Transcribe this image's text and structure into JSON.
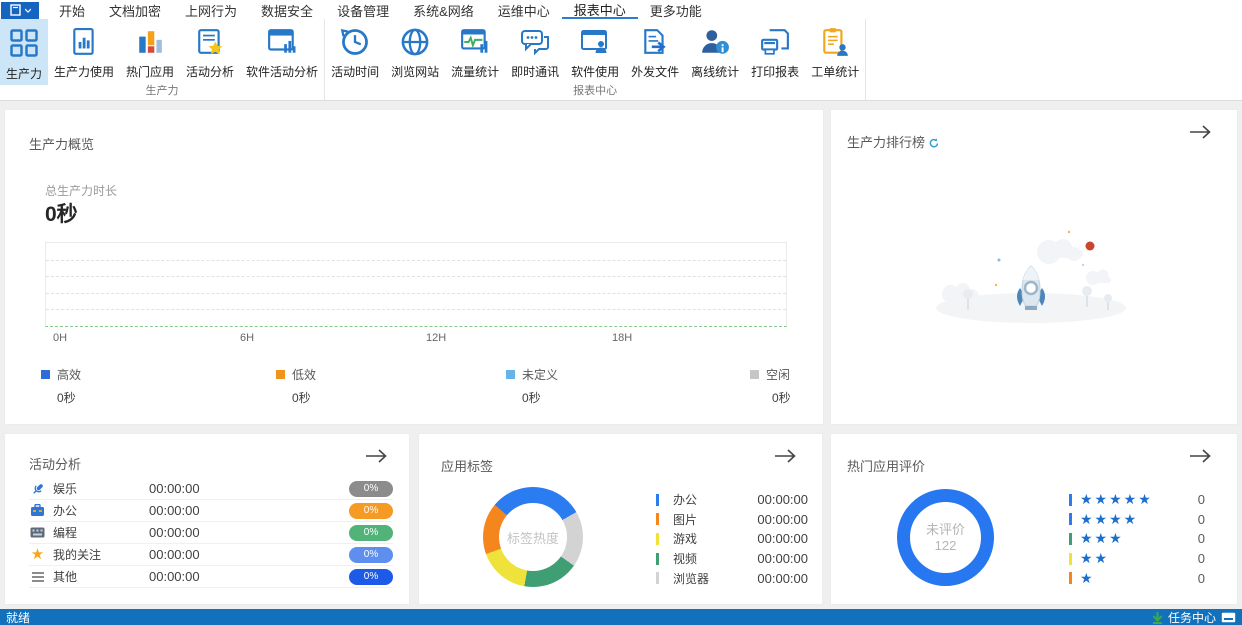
{
  "menu": {
    "items": [
      {
        "label": "开始"
      },
      {
        "label": "文档加密"
      },
      {
        "label": "上网行为"
      },
      {
        "label": "数据安全"
      },
      {
        "label": "设备管理"
      },
      {
        "label": "系统&网络"
      },
      {
        "label": "运维中心"
      },
      {
        "label": "报表中心"
      },
      {
        "label": "更多功能"
      }
    ],
    "active_label": "报表中心"
  },
  "ribbon": {
    "groups": [
      {
        "label": "生产力",
        "items": [
          {
            "label": "生产力"
          },
          {
            "label": "生产力使用"
          },
          {
            "label": "热门应用"
          },
          {
            "label": "活动分析"
          },
          {
            "label": "软件活动分析"
          }
        ]
      },
      {
        "label": "报表中心",
        "items": [
          {
            "label": "活动时间"
          },
          {
            "label": "浏览网站"
          },
          {
            "label": "流量统计"
          },
          {
            "label": "即时通讯"
          },
          {
            "label": "软件使用"
          },
          {
            "label": "外发文件"
          },
          {
            "label": "离线统计"
          },
          {
            "label": "打印报表"
          },
          {
            "label": "工单统计"
          }
        ]
      }
    ]
  },
  "overview": {
    "title": "生产力概览",
    "metric_label": "总生产力时长",
    "metric_value": "0秒",
    "x_labels": [
      "0H",
      "6H",
      "12H",
      "18H"
    ],
    "legend": [
      {
        "label": "高效",
        "value": "0秒",
        "color": "#2e6cd9"
      },
      {
        "label": "低效",
        "value": "0秒",
        "color": "#f0941c"
      },
      {
        "label": "未定义",
        "value": "0秒",
        "color": "#67b2e8"
      },
      {
        "label": "空闲",
        "value": "0秒",
        "color": "#c6c6c6"
      }
    ]
  },
  "ranking": {
    "title": "生产力排行榜"
  },
  "activity": {
    "title": "活动分析",
    "rows": [
      {
        "icon": "microphone-icon",
        "label": "娱乐",
        "time": "00:00:00",
        "percent": "0%",
        "badge_color": "#8c8c8c"
      },
      {
        "icon": "briefcase-icon",
        "label": "办公",
        "time": "00:00:00",
        "percent": "0%",
        "badge_color": "#f59a23"
      },
      {
        "icon": "keyboard-icon",
        "label": "编程",
        "time": "00:00:00",
        "percent": "0%",
        "badge_color": "#52b378"
      },
      {
        "icon": "star-icon",
        "label": "我的关注",
        "time": "00:00:00",
        "percent": "0%",
        "badge_color": "#5e8fee"
      },
      {
        "icon": "menu-lines-icon",
        "label": "其他",
        "time": "00:00:00",
        "percent": "0%",
        "badge_color": "#1e5ae8"
      }
    ]
  },
  "app_tags": {
    "title": "应用标签",
    "center_label": "标签热度",
    "rows": [
      {
        "label": "办公",
        "time": "00:00:00",
        "color": "#2b7cf0"
      },
      {
        "label": "图片",
        "time": "00:00:00",
        "color": "#f5851d"
      },
      {
        "label": "游戏",
        "time": "00:00:00",
        "color": "#efe23a"
      },
      {
        "label": "视频",
        "time": "00:00:00",
        "color": "#3f9e74"
      },
      {
        "label": "浏览器",
        "time": "00:00:00",
        "color": "#d3d3d3"
      }
    ],
    "donut": {
      "start_deg": -50,
      "segments": [
        {
          "name": "办公",
          "color": "#2b7cf0",
          "deg": 110
        },
        {
          "name": "浏览器",
          "color": "#d3d3d3",
          "deg": 65
        },
        {
          "name": "视频",
          "color": "#3f9e74",
          "deg": 65
        },
        {
          "name": "游戏",
          "color": "#efe23a",
          "deg": 60
        },
        {
          "name": "图片",
          "color": "#f5851d",
          "deg": 60
        }
      ]
    }
  },
  "ratings": {
    "title": "热门应用评价",
    "center_label": "未评价",
    "center_value": "122",
    "ring_color": "#2677f0",
    "rows": [
      {
        "stars": "★★★★★",
        "count": "0",
        "color": "#2b7cf0"
      },
      {
        "stars": "★★★★",
        "count": "0",
        "color": "#2b7cf0"
      },
      {
        "stars": "★★★",
        "count": "0",
        "color": "#3f9e74"
      },
      {
        "stars": "★★",
        "count": "0",
        "color": "#efe23a"
      },
      {
        "stars": "★",
        "count": "0",
        "color": "#f5851d"
      }
    ]
  },
  "statusbar": {
    "left": "就绪",
    "right": "任务中心"
  },
  "chart_data": [
    {
      "type": "area",
      "title": "生产力概览",
      "xlabel": "",
      "ylabel": "",
      "x_ticks": [
        "0H",
        "6H",
        "12H",
        "18H"
      ],
      "x_range_hours": [
        0,
        24
      ],
      "grid": "dashed-horizontal",
      "series": [
        {
          "name": "高效",
          "total": "0秒",
          "values": []
        },
        {
          "name": "低效",
          "total": "0秒",
          "values": []
        },
        {
          "name": "未定义",
          "total": "0秒",
          "values": []
        },
        {
          "name": "空闲",
          "total": "0秒",
          "values": []
        }
      ],
      "note": "empty chart, no data plotted"
    },
    {
      "type": "pie",
      "title": "应用标签",
      "center_text": "标签热度",
      "categories": [
        "办公",
        "图片",
        "游戏",
        "视频",
        "浏览器"
      ],
      "values": [
        "00:00:00",
        "00:00:00",
        "00:00:00",
        "00:00:00",
        "00:00:00"
      ],
      "colors": [
        "#2b7cf0",
        "#f5851d",
        "#efe23a",
        "#3f9e74",
        "#d3d3d3"
      ],
      "legend_position": "right"
    },
    {
      "type": "pie",
      "title": "热门应用评价",
      "center_text": "未评价 122",
      "categories": [
        "★★★★★",
        "★★★★",
        "★★★",
        "★★",
        "★"
      ],
      "values": [
        0,
        0,
        0,
        0,
        0
      ],
      "unrated_count": 122,
      "ring_color": "#2677f0",
      "legend_position": "right"
    }
  ]
}
